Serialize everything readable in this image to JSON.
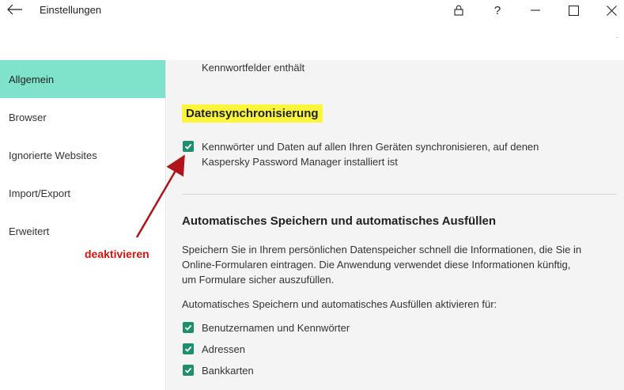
{
  "window": {
    "title": "Einstellungen",
    "icons": {
      "back": "arrow-left-icon",
      "lock": "lock-icon",
      "help": "?",
      "minimize": "minimize-icon",
      "maximize": "maximize-icon",
      "close": "close-icon"
    }
  },
  "sidebar": {
    "items": [
      {
        "label": "Allgemein",
        "active": true
      },
      {
        "label": "Browser",
        "active": false
      },
      {
        "label": "Ignorierte Websites",
        "active": false
      },
      {
        "label": "Import/Export",
        "active": false
      },
      {
        "label": "Erweitert",
        "active": false
      }
    ]
  },
  "main": {
    "truncated_text": "Kennwortfelder enthält",
    "sync": {
      "heading": "Datensynchronisierung",
      "checkbox_label_line1": "Kennwörter und Daten auf allen Ihren Geräten synchronisieren, auf denen",
      "checkbox_label_line2": "Kaspersky Password Manager installiert ist",
      "checked": true
    },
    "autofill": {
      "heading": "Automatisches Speichern und automatisches Ausfüllen",
      "description_line1": "Speichern Sie in Ihrem persönlichen Datenspeicher schnell die Informationen, die Sie in",
      "description_line2": "Online-Formularen eintragen. Die Anwendung verwendet diese Informationen künftig,",
      "description_line3": "um Formulare sicher auszufüllen.",
      "enable_for_label": "Automatisches Speichern und automatisches Ausfüllen aktivieren für:",
      "options": [
        {
          "label": "Benutzernamen und Kennwörter",
          "checked": true
        },
        {
          "label": "Adressen",
          "checked": true
        },
        {
          "label": "Bankkarten",
          "checked": true
        }
      ]
    }
  },
  "annotation": {
    "text": "deaktivieren",
    "color": "#d8120c"
  },
  "colors": {
    "accent": "#7fe3cc",
    "checkbox": "#1e8f6d",
    "highlight": "#fbf53c"
  }
}
